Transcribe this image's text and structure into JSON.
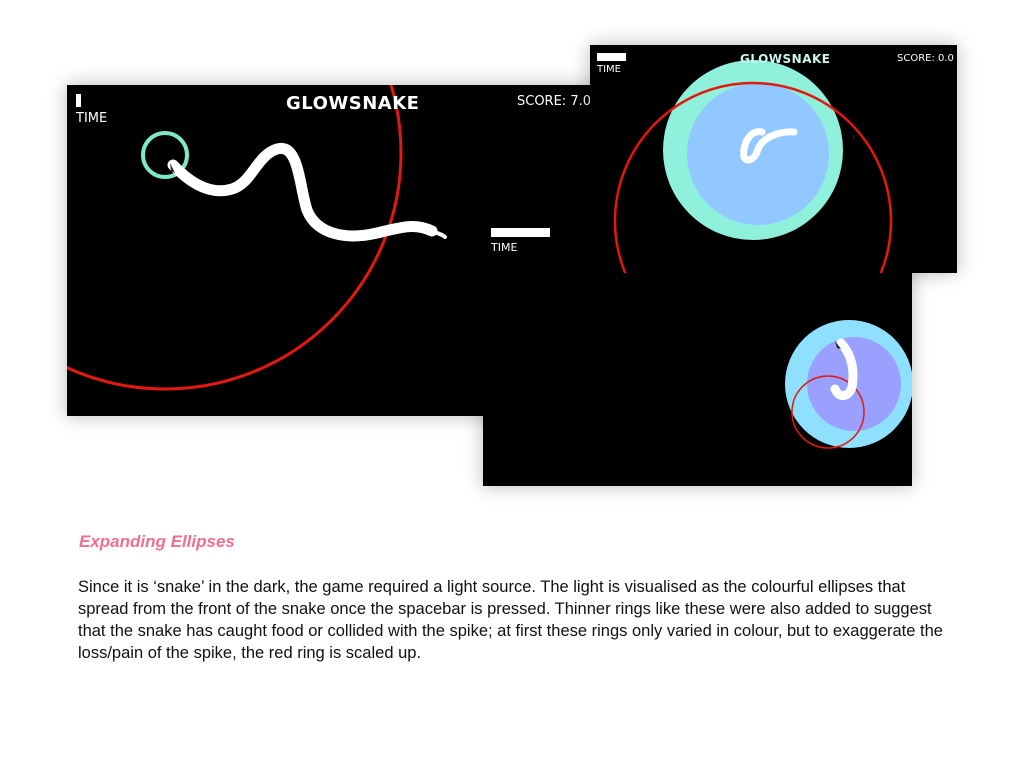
{
  "screens": {
    "main": {
      "time_label": "TIME",
      "title": "GLOWSNAKE",
      "score": "SCORE: 7.0"
    },
    "bottom": {
      "time_label": "TIME"
    },
    "top": {
      "time_label": "TIME",
      "title": "GLOWSNAKE",
      "score": "SCORE: 0.0"
    }
  },
  "colors": {
    "background": "#000000",
    "snake": "#ffffff",
    "spike_ring": "#e3180f",
    "mint_glow": "#8ff0dc",
    "light_blue_glow": "#90c8ff",
    "cyan_glow": "#8fe0ff",
    "periwinkle_glow": "#9aa0ff",
    "caption_heading": "#ef6f93"
  },
  "caption": {
    "heading": "Expanding Ellipses",
    "body": "Since it is ‘snake’ in the dark, the game required a light source. The light is visualised as the colourful ellipses that spread from the front of the snake once the spacebar is pressed. Thinner rings like these were also added to suggest that the snake has caught food or collided with the spike; at first these rings only varied in colour, but to exaggerate the loss/pain of the spike, the red ring is scaled up."
  }
}
